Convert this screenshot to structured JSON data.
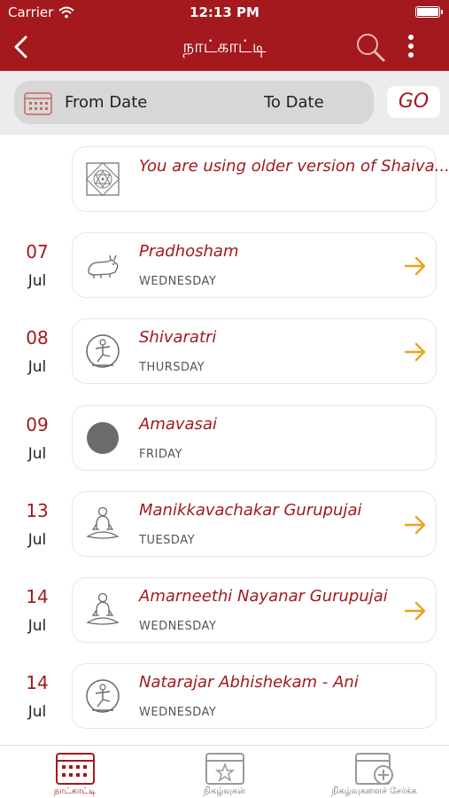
{
  "status_bar": {
    "carrier": "Carrier",
    "time": "12:13 PM"
  },
  "nav": {
    "title": "நாட்காட்டி",
    "icons": [
      "back-icon",
      "search-icon",
      "more-vertical-icon"
    ]
  },
  "filter": {
    "from_label": "From Date",
    "to_label": "To Date",
    "go_label": "GO"
  },
  "notice": {
    "text": "You are using older version of Shaiva..."
  },
  "events": [
    {
      "day": "07",
      "month": "Jul",
      "name": "Pradhosham",
      "weekday": "WEDNESDAY",
      "icon": "nandi-icon",
      "has_arrow": true
    },
    {
      "day": "08",
      "month": "Jul",
      "name": "Shivaratri",
      "weekday": "THURSDAY",
      "icon": "nataraja-icon",
      "has_arrow": true
    },
    {
      "day": "09",
      "month": "Jul",
      "name": "Amavasai",
      "weekday": "FRIDAY",
      "icon": "new-moon-icon",
      "has_arrow": false
    },
    {
      "day": "13",
      "month": "Jul",
      "name": "Manikkavachakar Gurupujai",
      "weekday": "TUESDAY",
      "icon": "meditating-saint-icon",
      "has_arrow": true
    },
    {
      "day": "14",
      "month": "Jul",
      "name": "Amarneethi Nayanar Gurupujai",
      "weekday": "WEDNESDAY",
      "icon": "meditating-saint-icon",
      "has_arrow": true
    },
    {
      "day": "14",
      "month": "Jul",
      "name": "Natarajar Abhishekam - Ani",
      "weekday": "WEDNESDAY",
      "icon": "nataraja-icon",
      "has_arrow": false
    }
  ],
  "tabs": [
    {
      "label": "நாட்காட்டி",
      "icon": "calendar-icon",
      "active": true
    },
    {
      "label": "நிகழ்வுகள்",
      "icon": "calendar-star-icon",
      "active": false
    },
    {
      "label": "நிகழ்வுகளைச் சேர்க்க",
      "icon": "calendar-add-icon",
      "active": false
    }
  ],
  "colors": {
    "primary": "#a3191d",
    "arrow": "#f0a01a",
    "filter_bg": "#ececec",
    "pill_bg": "#d7d7d7"
  }
}
